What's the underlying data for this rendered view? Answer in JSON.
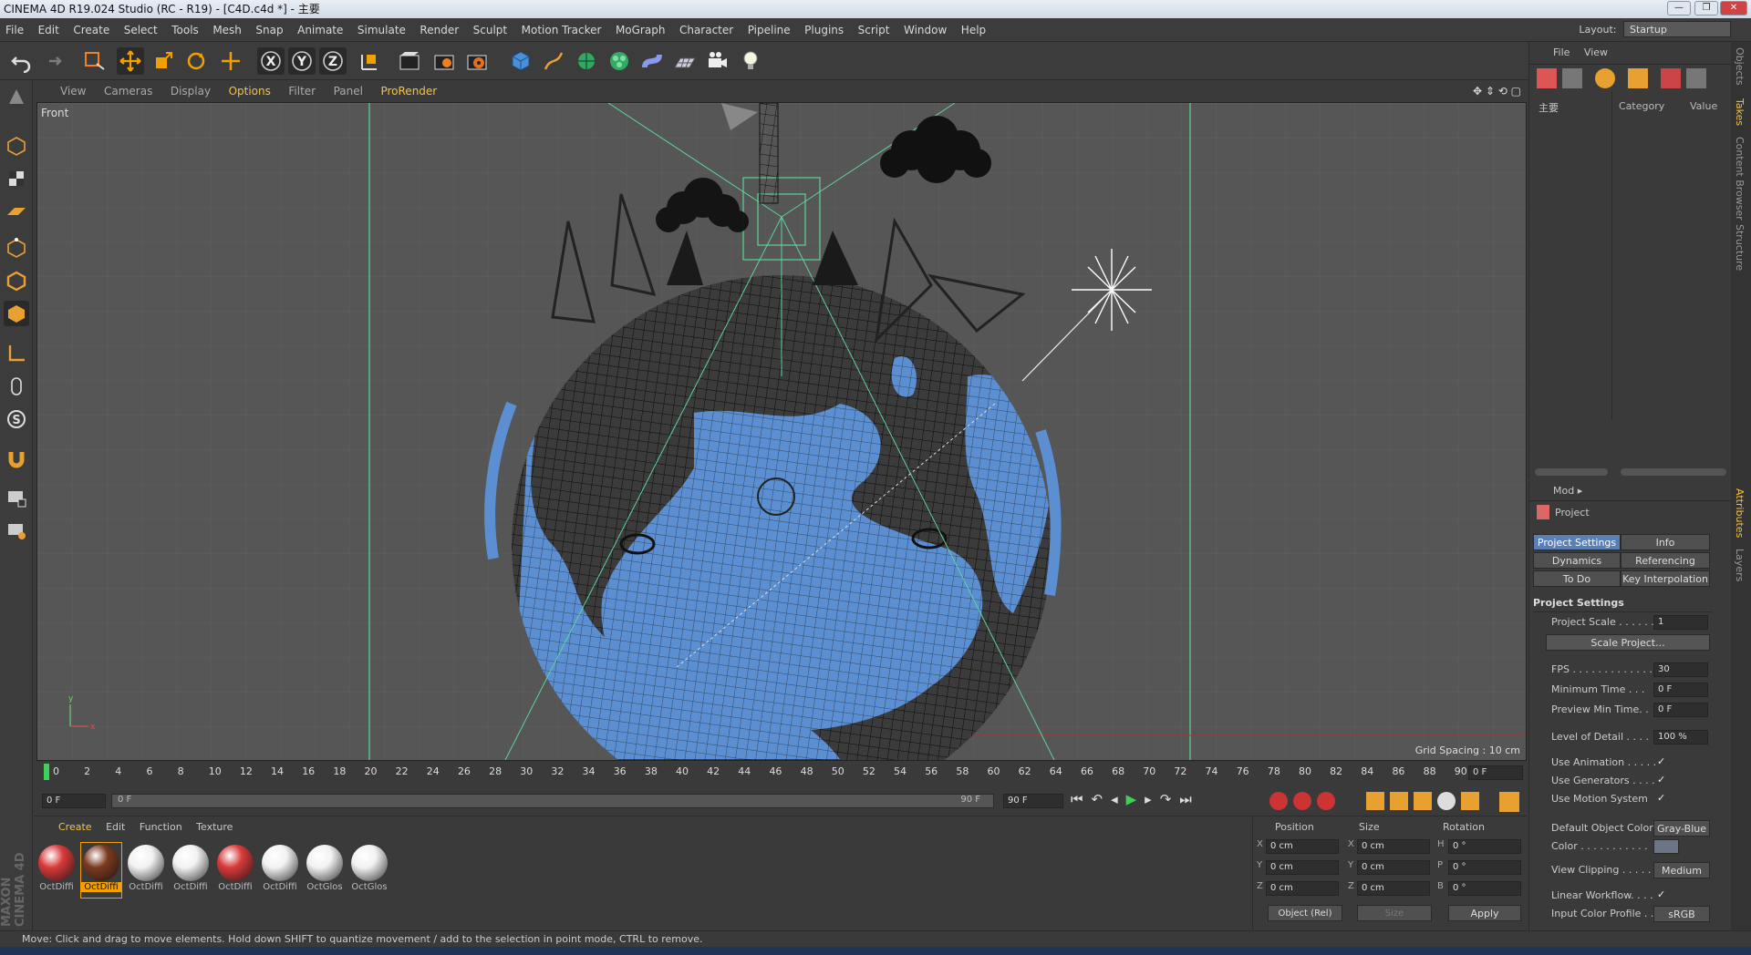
{
  "window": {
    "title": "CINEMA 4D R19.024 Studio (RC - R19) - [C4D.c4d *] - 主要"
  },
  "menu": {
    "items": [
      "File",
      "Edit",
      "Create",
      "Select",
      "Tools",
      "Mesh",
      "Snap",
      "Animate",
      "Simulate",
      "Render",
      "Sculpt",
      "Motion Tracker",
      "MoGraph",
      "Character",
      "Pipeline",
      "Plugins",
      "Script",
      "Window",
      "Help"
    ],
    "layout_label": "Layout:",
    "layout_value": "Startup"
  },
  "viewport": {
    "menu": [
      "View",
      "Cameras",
      "Display",
      "Options",
      "Filter",
      "Panel",
      "ProRender"
    ],
    "label": "Front",
    "grid_spacing": "Grid Spacing : 10 cm"
  },
  "timeline": {
    "ticks": [
      "0",
      "2",
      "4",
      "6",
      "8",
      "10",
      "12",
      "14",
      "16",
      "18",
      "20",
      "22",
      "24",
      "26",
      "28",
      "30",
      "32",
      "34",
      "36",
      "38",
      "40",
      "42",
      "44",
      "46",
      "48",
      "50",
      "52",
      "54",
      "56",
      "58",
      "60",
      "62",
      "64",
      "66",
      "68",
      "70",
      "72",
      "74",
      "76",
      "78",
      "80",
      "82",
      "84",
      "86",
      "88",
      "90"
    ],
    "current_frame": "0 F",
    "start": "0 F",
    "range_start": "0 F",
    "range_end": "90 F",
    "end": "90 F"
  },
  "materials": {
    "menu": [
      "Create",
      "Edit",
      "Function",
      "Texture"
    ],
    "items": [
      {
        "label": "OctDiffi",
        "color": "#d93a3a"
      },
      {
        "label": "OctDiffi",
        "color": "#7a3a1e"
      },
      {
        "label": "OctDiffi",
        "color": "#f2f2f2"
      },
      {
        "label": "OctDiffi",
        "color": "#f2f2f2"
      },
      {
        "label": "OctDiffi",
        "color": "#d93a3a"
      },
      {
        "label": "OctDiffi",
        "color": "#f2f2f2"
      },
      {
        "label": "OctGlos",
        "color": "#f2f2f2"
      },
      {
        "label": "OctGlos",
        "color": "#f2f2f2"
      }
    ],
    "brand": "MAXON CINEMA 4D"
  },
  "coords": {
    "headers": [
      "Position",
      "Size",
      "Rotation"
    ],
    "rows": [
      {
        "a": "X",
        "pos": "0 cm",
        "b": "X",
        "size": "0 cm",
        "c": "H",
        "rot": "0 °"
      },
      {
        "a": "Y",
        "pos": "0 cm",
        "b": "Y",
        "size": "0 cm",
        "c": "P",
        "rot": "0 °"
      },
      {
        "a": "Z",
        "pos": "0 cm",
        "b": "Z",
        "size": "0 cm",
        "c": "B",
        "rot": "0 °"
      }
    ],
    "mode": "Object (Rel)",
    "size_mode": "Size",
    "apply": "Apply"
  },
  "objects": {
    "menu": [
      "File",
      "View"
    ],
    "col_category": "Category",
    "col_value": "Value",
    "item": "主要"
  },
  "attributes": {
    "mode": "Mod",
    "title": "Project",
    "tabs": [
      "Project Settings",
      "Info",
      "Dynamics",
      "Referencing",
      "To Do",
      "Key Interpolation"
    ],
    "section": "Project Settings",
    "rows": [
      {
        "label": "Project Scale . . . . . .",
        "value": "1"
      },
      {
        "label": "FPS . . . . . . . . . . . . . .",
        "value": "30"
      },
      {
        "label": "Minimum Time . . .",
        "value": "0 F"
      },
      {
        "label": "Preview Min Time. .",
        "value": "0 F"
      },
      {
        "label": "Level of Detail . . . .",
        "value": "100 %"
      }
    ],
    "scale_btn": "Scale Project...",
    "checks": [
      "Use Animation . . . . .",
      "Use Generators . . . .",
      "Use Motion System"
    ],
    "default_color_label": "Default Object Color",
    "default_color_value": "Gray-Blue",
    "color_label": "Color . . . . . . . . . . .",
    "view_clipping_label": "View Clipping . . . . .",
    "view_clipping_value": "Medium",
    "linear_workflow": "Linear Workflow. . . .",
    "input_profile_label": "Input Color Profile . .",
    "input_profile_value": "sRGB"
  },
  "sidetabs": [
    "Objects",
    "Takes",
    "Content Browser",
    "Structure",
    "Attributes",
    "Layers"
  ],
  "status": "Move: Click and drag to move elements. Hold down SHIFT to quantize movement / add to the selection in point mode, CTRL to remove."
}
